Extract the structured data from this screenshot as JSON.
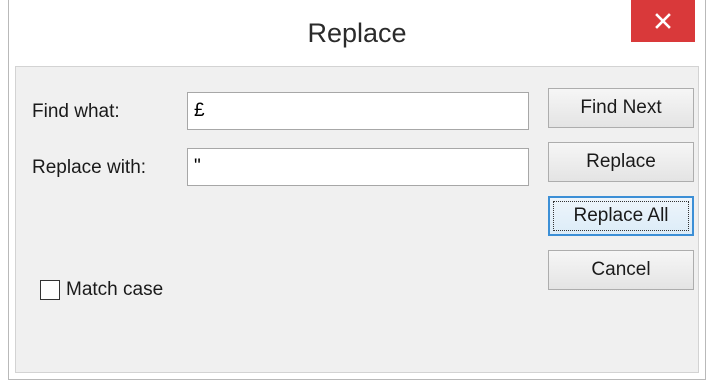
{
  "window": {
    "title": "Replace",
    "close_icon": "close-icon"
  },
  "fields": {
    "find_label": "Find what:",
    "find_value": "£",
    "replace_label": "Replace with:",
    "replace_value": "\""
  },
  "buttons": {
    "find_next": "Find Next",
    "replace": "Replace",
    "replace_all": "Replace All",
    "cancel": "Cancel"
  },
  "options": {
    "match_case_label": "Match case",
    "match_case_checked": false
  },
  "colors": {
    "close_button": "#d9393a",
    "default_button_border": "#3c8fd6",
    "client_background": "#f0f0f0"
  }
}
